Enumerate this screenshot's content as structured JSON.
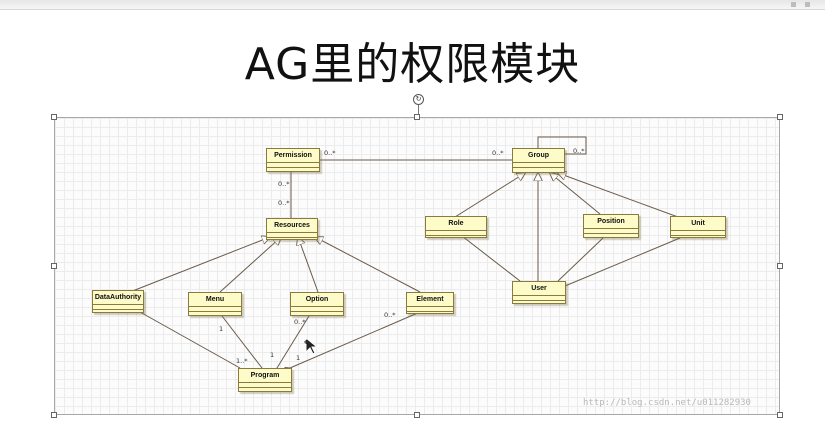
{
  "slide": {
    "title": "AG里的权限模块"
  },
  "diagram": {
    "classes": {
      "permission": "Permission",
      "resources": "Resources",
      "data_authority": "DataAuthority",
      "menu": "Menu",
      "option": "Option",
      "element": "Element",
      "program": "Program",
      "group": "Group",
      "role": "Role",
      "position": "Position",
      "unit": "Unit",
      "user": "User"
    },
    "multiplicities": {
      "perm_group_left": "0..*",
      "perm_group_right": "0..*",
      "group_self": "0..*",
      "perm_res_top": "0..*",
      "perm_res_bottom": "0..*",
      "menu_program": "1",
      "option_program": "0..*",
      "element_program": "0..*",
      "program_left": "1..*",
      "program_mid_1": "1",
      "program_mid_2": "1"
    },
    "colors": {
      "class_fill": "#fdfbc8",
      "class_border": "#8a7a40",
      "line": "#6a5a4a"
    }
  },
  "watermark": "http://blog.csdn.net/u011282930"
}
